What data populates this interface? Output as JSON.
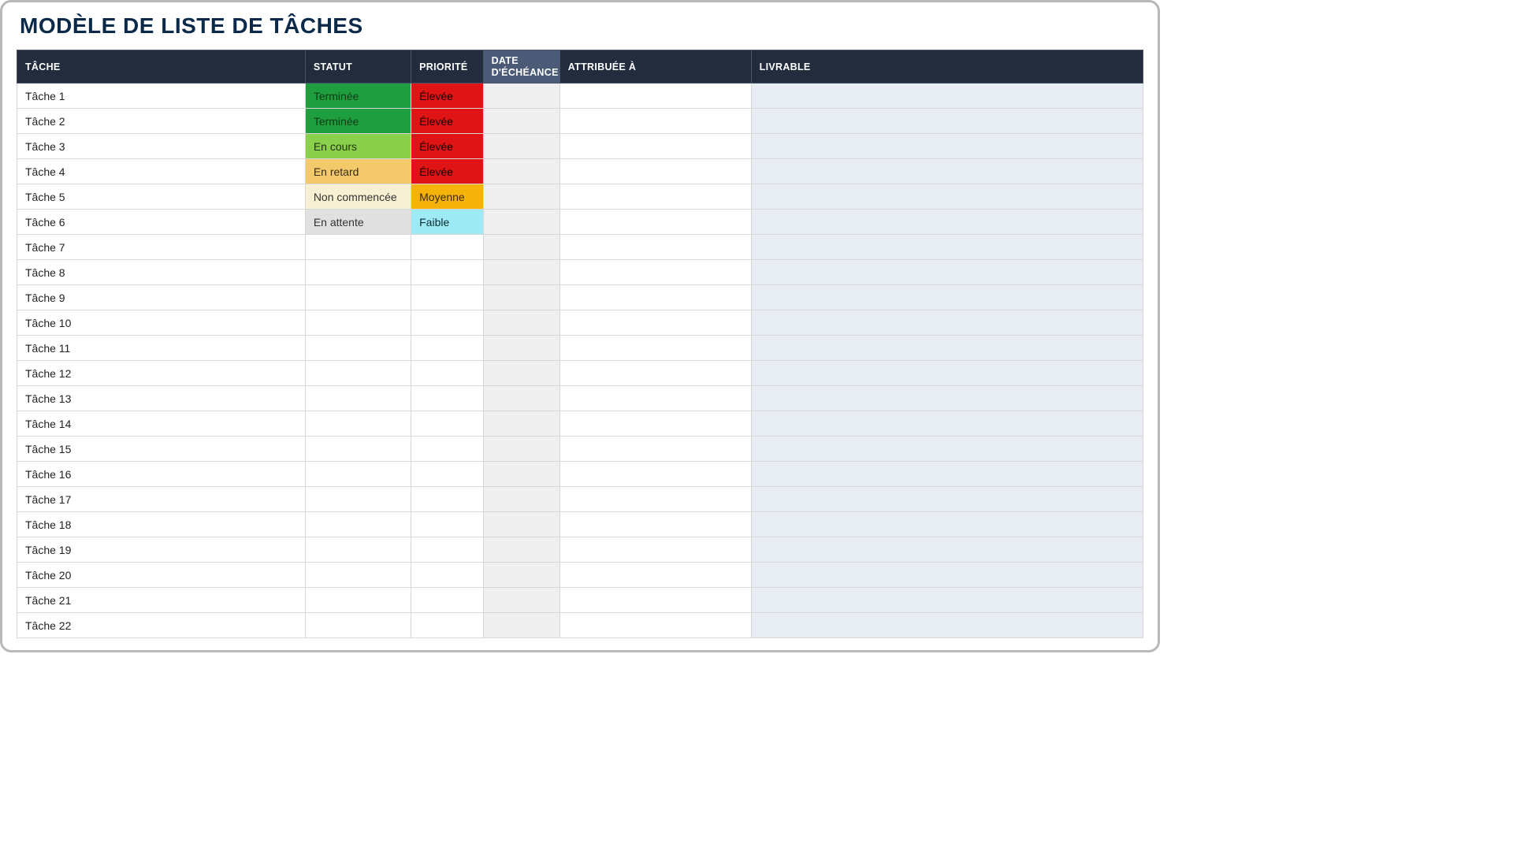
{
  "title": "MODÈLE DE LISTE DE TÂCHES",
  "columns": {
    "task": "TÂCHE",
    "status": "STATUT",
    "priority": "PRIORITÉ",
    "due": "DATE D'ÉCHÉANCE",
    "assigned": "ATTRIBUÉE À",
    "deliverable": "LIVRABLE"
  },
  "status_styles": {
    "Terminée": "terminee",
    "En cours": "encours",
    "En retard": "enretard",
    "Non commencée": "noncommencee",
    "En attente": "enattente"
  },
  "priority_styles": {
    "Élevée": "elevee",
    "Moyenne": "moyenne",
    "Faible": "faible"
  },
  "rows": [
    {
      "task": "Tâche 1",
      "status": "Terminée",
      "priority": "Élevée",
      "due": "",
      "assigned": "",
      "deliverable": ""
    },
    {
      "task": "Tâche 2",
      "status": "Terminée",
      "priority": "Élevée",
      "due": "",
      "assigned": "",
      "deliverable": ""
    },
    {
      "task": "Tâche 3",
      "status": "En cours",
      "priority": "Élevée",
      "due": "",
      "assigned": "",
      "deliverable": ""
    },
    {
      "task": "Tâche 4",
      "status": "En retard",
      "priority": "Élevée",
      "due": "",
      "assigned": "",
      "deliverable": ""
    },
    {
      "task": "Tâche 5",
      "status": "Non commencée",
      "priority": "Moyenne",
      "due": "",
      "assigned": "",
      "deliverable": ""
    },
    {
      "task": "Tâche 6",
      "status": "En attente",
      "priority": "Faible",
      "due": "",
      "assigned": "",
      "deliverable": ""
    },
    {
      "task": "Tâche 7",
      "status": "",
      "priority": "",
      "due": "",
      "assigned": "",
      "deliverable": ""
    },
    {
      "task": "Tâche 8",
      "status": "",
      "priority": "",
      "due": "",
      "assigned": "",
      "deliverable": ""
    },
    {
      "task": "Tâche 9",
      "status": "",
      "priority": "",
      "due": "",
      "assigned": "",
      "deliverable": ""
    },
    {
      "task": "Tâche 10",
      "status": "",
      "priority": "",
      "due": "",
      "assigned": "",
      "deliverable": ""
    },
    {
      "task": "Tâche 11",
      "status": "",
      "priority": "",
      "due": "",
      "assigned": "",
      "deliverable": ""
    },
    {
      "task": "Tâche 12",
      "status": "",
      "priority": "",
      "due": "",
      "assigned": "",
      "deliverable": ""
    },
    {
      "task": "Tâche 13",
      "status": "",
      "priority": "",
      "due": "",
      "assigned": "",
      "deliverable": ""
    },
    {
      "task": "Tâche 14",
      "status": "",
      "priority": "",
      "due": "",
      "assigned": "",
      "deliverable": ""
    },
    {
      "task": "Tâche 15",
      "status": "",
      "priority": "",
      "due": "",
      "assigned": "",
      "deliverable": ""
    },
    {
      "task": "Tâche 16",
      "status": "",
      "priority": "",
      "due": "",
      "assigned": "",
      "deliverable": ""
    },
    {
      "task": "Tâche 17",
      "status": "",
      "priority": "",
      "due": "",
      "assigned": "",
      "deliverable": ""
    },
    {
      "task": "Tâche 18",
      "status": "",
      "priority": "",
      "due": "",
      "assigned": "",
      "deliverable": ""
    },
    {
      "task": "Tâche 19",
      "status": "",
      "priority": "",
      "due": "",
      "assigned": "",
      "deliverable": ""
    },
    {
      "task": "Tâche 20",
      "status": "",
      "priority": "",
      "due": "",
      "assigned": "",
      "deliverable": ""
    },
    {
      "task": "Tâche 21",
      "status": "",
      "priority": "",
      "due": "",
      "assigned": "",
      "deliverable": ""
    },
    {
      "task": "Tâche 22",
      "status": "",
      "priority": "",
      "due": "",
      "assigned": "",
      "deliverable": ""
    }
  ]
}
